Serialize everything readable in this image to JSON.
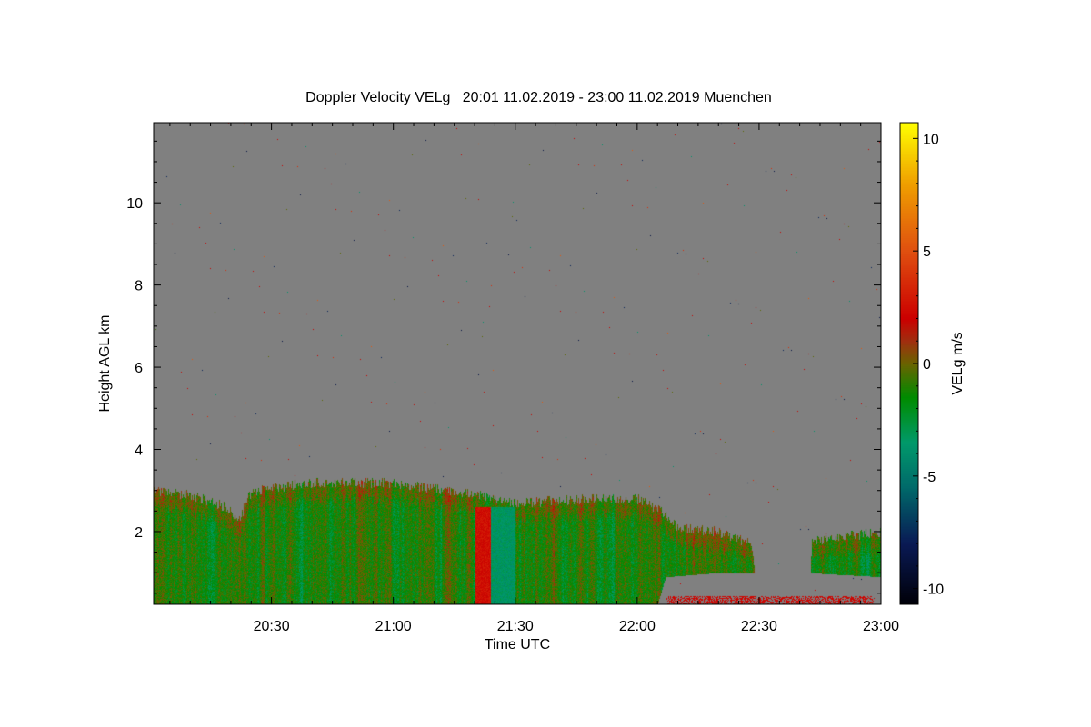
{
  "chart_data": {
    "type": "heatmap",
    "title": "Doppler Velocity VELg   20:01 11.02.2019 - 23:00 11.02.2019 Muenchen",
    "xlabel": "Time UTC",
    "ylabel": "Height AGL km",
    "colorbar_label": "VELg m/s",
    "xlim": [
      "20:01",
      "23:00"
    ],
    "ylim": [
      0.23,
      11.95
    ],
    "x_ticks": [
      "20:30",
      "21:00",
      "21:30",
      "22:00",
      "22:30",
      "23:00"
    ],
    "y_ticks": [
      2,
      4,
      6,
      8,
      10
    ],
    "colorbar_ticks": [
      10,
      5,
      0,
      -5,
      -10
    ],
    "colorbar_range": [
      -10.7,
      10.7
    ],
    "background_color": "#808080",
    "colormap": [
      {
        "v": -10.7,
        "c": "#000008"
      },
      {
        "v": -8,
        "c": "#0a1a55"
      },
      {
        "v": -5.5,
        "c": "#006a6a"
      },
      {
        "v": -3.5,
        "c": "#009a6a"
      },
      {
        "v": -1.5,
        "c": "#008c00"
      },
      {
        "v": 0,
        "c": "#6a6400"
      },
      {
        "v": 1,
        "c": "#a03010"
      },
      {
        "v": 2,
        "c": "#cc0000"
      },
      {
        "v": 5,
        "c": "#e05010"
      },
      {
        "v": 8,
        "c": "#f0a000"
      },
      {
        "v": 10.7,
        "c": "#ffff00"
      }
    ],
    "cloud_top_km": [
      {
        "t": "20:01",
        "h": 3.0
      },
      {
        "t": "20:10",
        "h": 2.9
      },
      {
        "t": "20:19",
        "h": 2.6
      },
      {
        "t": "20:22",
        "h": 2.3
      },
      {
        "t": "20:25",
        "h": 3.0
      },
      {
        "t": "20:40",
        "h": 3.2
      },
      {
        "t": "21:00",
        "h": 3.2
      },
      {
        "t": "21:20",
        "h": 2.9
      },
      {
        "t": "21:30",
        "h": 2.7
      },
      {
        "t": "21:45",
        "h": 2.8
      },
      {
        "t": "22:00",
        "h": 2.8
      },
      {
        "t": "22:06",
        "h": 2.5
      },
      {
        "t": "22:10",
        "h": 2.1
      },
      {
        "t": "22:20",
        "h": 2.0
      },
      {
        "t": "22:28",
        "h": 1.7
      },
      {
        "t": "22:30",
        "h": 0.0
      },
      {
        "t": "22:42",
        "h": 0.0
      },
      {
        "t": "22:43",
        "h": 1.8
      },
      {
        "t": "23:00",
        "h": 2.0
      }
    ],
    "cloud_base_km": [
      {
        "t": "20:01",
        "h": 0.23
      },
      {
        "t": "22:05",
        "h": 0.23
      },
      {
        "t": "22:07",
        "h": 0.9
      },
      {
        "t": "22:20",
        "h": 1.0
      },
      {
        "t": "22:42",
        "h": 1.0
      },
      {
        "t": "23:00",
        "h": 0.9
      }
    ],
    "features": [
      {
        "name": "updraft",
        "t_start": "21:20",
        "t_end": "21:24",
        "value": 2.5
      },
      {
        "name": "downdraft",
        "t_start": "21:24",
        "t_end": "21:30",
        "value": -3.5
      }
    ]
  }
}
